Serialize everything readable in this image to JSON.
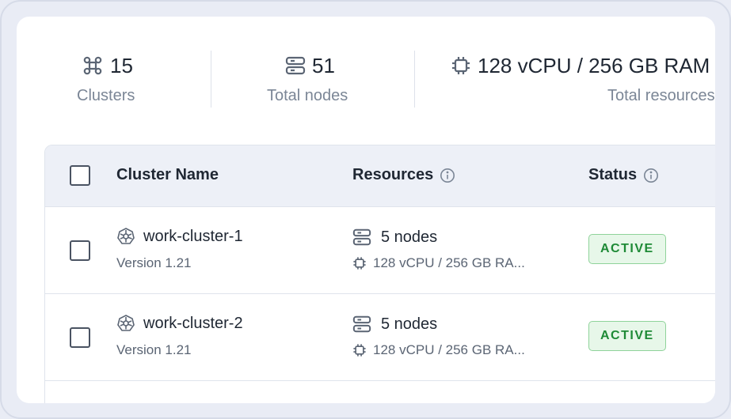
{
  "stats": [
    {
      "icon": "cluster-icon",
      "value": "15",
      "label": "Clusters"
    },
    {
      "icon": "server-icon",
      "value": "51",
      "label": "Total nodes"
    },
    {
      "icon": "cpu-icon",
      "value": "128 vCPU / 256 GB RAM",
      "label": "Total resources"
    }
  ],
  "table": {
    "headers": {
      "name": "Cluster Name",
      "resources": "Resources",
      "status": "Status"
    },
    "rows": [
      {
        "name": "work-cluster-1",
        "version": "Version 1.21",
        "nodes": "5 nodes",
        "resources": "128 vCPU / 256 GB RA...",
        "status": "ACTIVE"
      },
      {
        "name": "work-cluster-2",
        "version": "Version 1.21",
        "nodes": "5 nodes",
        "resources": "128 vCPU / 256 GB RA...",
        "status": "ACTIVE"
      }
    ]
  },
  "colors": {
    "accent_green": "#1e8a36",
    "badge_bg": "#e7f7e9",
    "header_bg": "#edf0f7",
    "icon_gray": "#5b6574"
  }
}
